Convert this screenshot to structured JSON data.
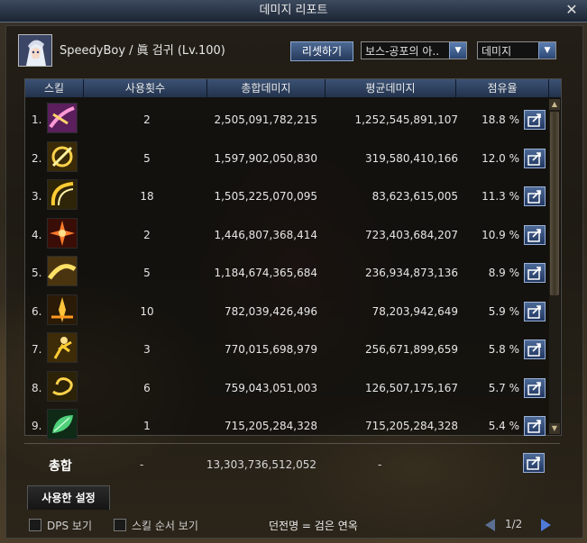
{
  "window": {
    "title": "데미지 리포트",
    "close_symbol": "✕"
  },
  "player": {
    "name": "SpeedyBoy / 眞 검귀 (Lv.100)"
  },
  "controls": {
    "reset_label": "리셋하기",
    "dungeon_select": "보스-공포의 아..",
    "metric_select": "데미지"
  },
  "table": {
    "headers": {
      "skill": "스킬",
      "uses": "사용횟수",
      "total": "총합데미지",
      "avg": "평균데미지",
      "share": "점유율"
    },
    "rows": [
      {
        "rank": "1.",
        "uses": "2",
        "total": "2,505,091,782,215",
        "avg": "1,252,545,891,107",
        "share": "18.8 %",
        "icon": "skill-icon-purple-slash"
      },
      {
        "rank": "2.",
        "uses": "5",
        "total": "1,597,902,050,830",
        "avg": "319,580,410,166",
        "share": "12.0 %",
        "icon": "skill-icon-gold-spiral"
      },
      {
        "rank": "3.",
        "uses": "18",
        "total": "1,505,225,070,095",
        "avg": "83,623,615,005",
        "share": "11.3 %",
        "icon": "skill-icon-gold-arc"
      },
      {
        "rank": "4.",
        "uses": "2",
        "total": "1,446,807,368,414",
        "avg": "723,403,684,207",
        "share": "10.9 %",
        "icon": "skill-icon-red-burst"
      },
      {
        "rank": "5.",
        "uses": "5",
        "total": "1,184,674,365,684",
        "avg": "236,934,873,136",
        "share": "8.9 %",
        "icon": "skill-icon-gold-wave"
      },
      {
        "rank": "6.",
        "uses": "10",
        "total": "782,039,426,496",
        "avg": "78,203,942,649",
        "share": "5.9 %",
        "icon": "skill-icon-gold-flame"
      },
      {
        "rank": "7.",
        "uses": "3",
        "total": "770,015,698,979",
        "avg": "256,671,899,659",
        "share": "5.8 %",
        "icon": "skill-icon-gold-figure"
      },
      {
        "rank": "8.",
        "uses": "6",
        "total": "759,043,051,003",
        "avg": "126,507,175,167",
        "share": "5.7 %",
        "icon": "skill-icon-gold-swirl"
      },
      {
        "rank": "9.",
        "uses": "1",
        "total": "715,205,284,328",
        "avg": "715,205,284,328",
        "share": "5.4 %",
        "icon": "skill-icon-green-leaf"
      }
    ]
  },
  "totals": {
    "label": "총합",
    "uses": "-",
    "total": "13,303,736,512,052",
    "avg": "-"
  },
  "tabs": {
    "settings": "사용한 설정"
  },
  "footer": {
    "dps_label": "DPS 보기",
    "order_label": "스킬 순서 보기",
    "legend": "던전명 = 검은 연옥",
    "page": "1/2"
  }
}
